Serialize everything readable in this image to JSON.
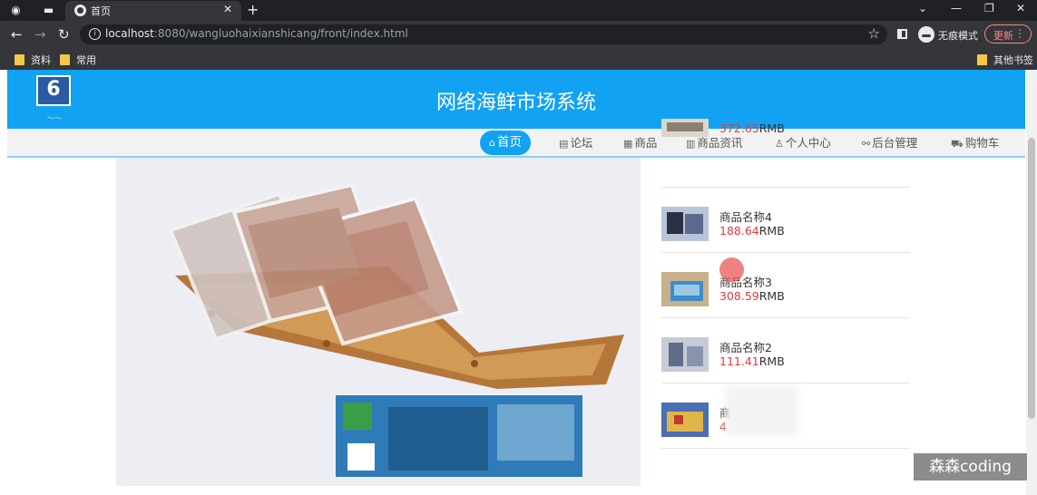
{
  "browser": {
    "tab_title": "首页",
    "url_host": "localhost",
    "url_rest": ":8080/wangluohaixianshicang/front/index.html",
    "incognito_label": "无痕模式",
    "update_label": "更新",
    "bookmarks": [
      "资料",
      "常用"
    ],
    "other_bookmarks": "其他书签"
  },
  "site": {
    "title": "网络海鲜市场系统",
    "nav": [
      {
        "label": "首页",
        "icon": "home-icon"
      },
      {
        "label": "论坛",
        "icon": "forum-icon"
      },
      {
        "label": "商品",
        "icon": "goods-icon"
      },
      {
        "label": "商品资讯",
        "icon": "news-icon"
      },
      {
        "label": "个人中心",
        "icon": "user-icon"
      },
      {
        "label": "后台管理",
        "icon": "link-icon"
      },
      {
        "label": "购物车",
        "icon": "cart-icon"
      }
    ]
  },
  "products": [
    {
      "name": "",
      "price": "372.65",
      "unit": "RMB"
    },
    {
      "name": "商品名称4",
      "price": "188.64",
      "unit": "RMB"
    },
    {
      "name": "商品名称3",
      "price": "308.59",
      "unit": "RMB"
    },
    {
      "name": "商品名称2",
      "price": "111.41",
      "unit": "RMB"
    },
    {
      "name": "商",
      "price": "4",
      "unit": ""
    }
  ],
  "watermark": "森森coding"
}
